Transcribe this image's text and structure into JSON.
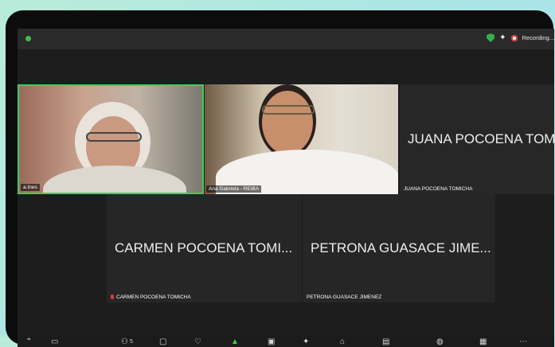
{
  "app": {
    "recording_label": "Recording..."
  },
  "participants": [
    {
      "name_tag": "a.Ines",
      "display_text": "",
      "has_video": true
    },
    {
      "name_tag": "Ana Gabriela - REIBA",
      "display_text": "",
      "has_video": true
    },
    {
      "name_tag": "JUANA POCOENA TOMICHA",
      "display_text": "JUANA POCOENA TOM",
      "has_video": false
    },
    {
      "name_tag": "CARMEN POCOENA TOMICHA",
      "display_text": "CARMEN POCOENA TOMI...",
      "has_video": false,
      "muted": true
    },
    {
      "name_tag": "PETRONA GUASACE JIMENEZ",
      "display_text": "PETRONA GUASACE JIME...",
      "has_video": false
    }
  ],
  "toolbar": {
    "participants_count": "5"
  },
  "colors": {
    "active_speaker": "#3bd15a",
    "recording": "#e23b3b",
    "status": "#39c24a"
  },
  "icons": [
    "shield-icon",
    "sparkle-icon",
    "record-icon",
    "mic-icon",
    "video-icon",
    "participants-icon",
    "chat-icon",
    "share-screen-icon",
    "apps-icon",
    "view-icon",
    "more-icon"
  ]
}
